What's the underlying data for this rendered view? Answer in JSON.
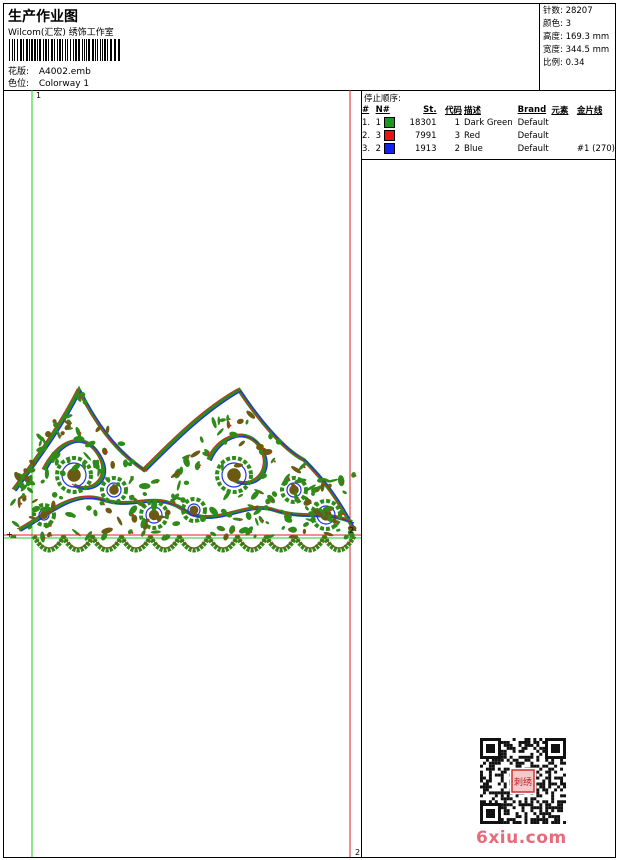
{
  "header": {
    "title": "生产作业图",
    "subtitle": "Wilcom(汇宏) 绣饰工作室",
    "design_label": "花版:",
    "design_value": "A4002.emb",
    "colorway_label": "色位:",
    "colorway_value": "Colorway 1"
  },
  "stats": {
    "stitches": "针数: 28207",
    "colors": "颜色: 3",
    "height": "高度: 169.3 mm",
    "width": "宽度: 344.5 mm",
    "scale": "比例: 0.34"
  },
  "markers": {
    "top_left": "1",
    "right_mid": "2",
    "bottom_right": "2",
    "cross": "+"
  },
  "sequence": {
    "title": "停止顺序:",
    "headers": [
      "#",
      "N#",
      "St.",
      "代码",
      "描述",
      "Brand",
      "元素",
      "金片线"
    ],
    "rows": [
      {
        "idx": "1.",
        "n": "1",
        "color": "#1a9a1a",
        "st": "18301",
        "code": "1",
        "desc": "Dark Green",
        "brand": "Default",
        "elem": "",
        "seq": ""
      },
      {
        "idx": "2.",
        "n": "3",
        "color": "#ee1111",
        "st": "7991",
        "code": "3",
        "desc": "Red",
        "brand": "Default",
        "elem": "",
        "seq": ""
      },
      {
        "idx": "3.",
        "n": "2",
        "color": "#1122ee",
        "st": "1913",
        "code": "2",
        "desc": "Blue",
        "brand": "Default",
        "elem": "",
        "seq": "#1 (270)"
      }
    ]
  },
  "watermark": "6xiu.com",
  "qr_badge": "刺绣"
}
